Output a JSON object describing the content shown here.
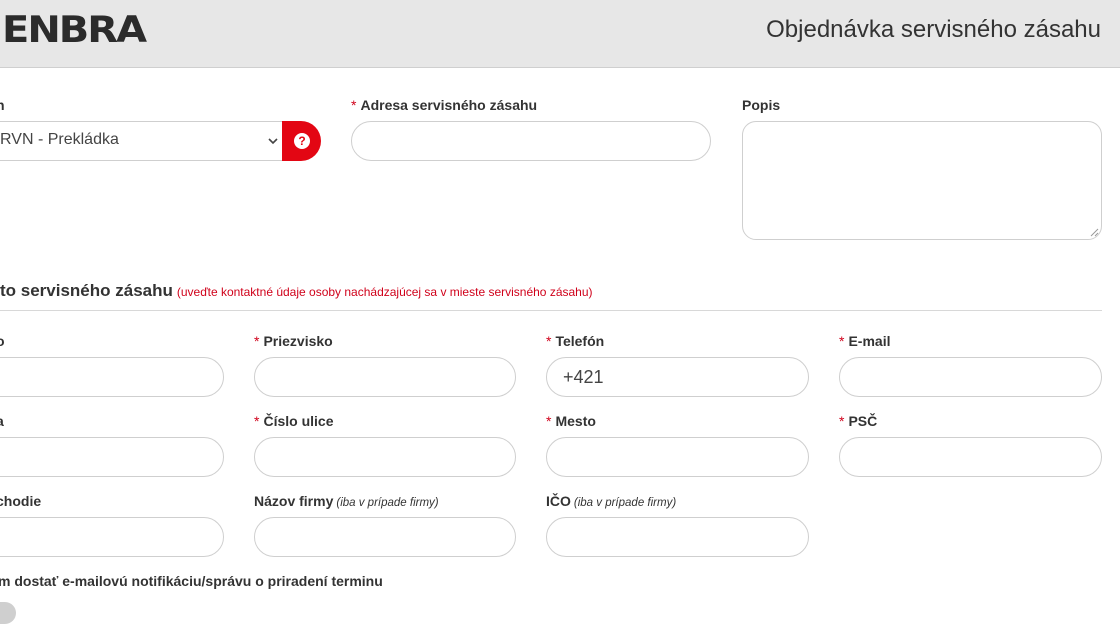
{
  "header": {
    "logo": "ENBRA",
    "title": "Objednávka servisného zásahu"
  },
  "order": {
    "type_label": "n",
    "type_value": "RVN - Prekládka",
    "address_label": "Adresa servisného zásahu",
    "description_label": "Popis"
  },
  "contact": {
    "section_title": "to servisného zásahu",
    "section_note": "(uveďte kontaktné údaje osoby nachádzajúcej sa v mieste servisného zásahu)",
    "first_name_label": "o",
    "last_name_label": "Priezvisko",
    "phone_label": "Telefón",
    "phone_value": "+421",
    "email_label": "E-mail",
    "street_label": "a",
    "street_number_label": "Číslo ulice",
    "city_label": "Mesto",
    "zip_label": "PSČ",
    "shop_label": "chodie",
    "company_label": "Názov firmy",
    "company_hint": "(iba v prípade firmy)",
    "ico_label": "IČO",
    "ico_hint": "(iba v prípade firmy)",
    "notify_label": "m dostať e-mailovú notifikáciu/správu o priradení terminu"
  },
  "required_marker": "*",
  "colors": {
    "accent": "#e30613",
    "required": "#d0021b",
    "header_bg": "#e7e7e7"
  }
}
